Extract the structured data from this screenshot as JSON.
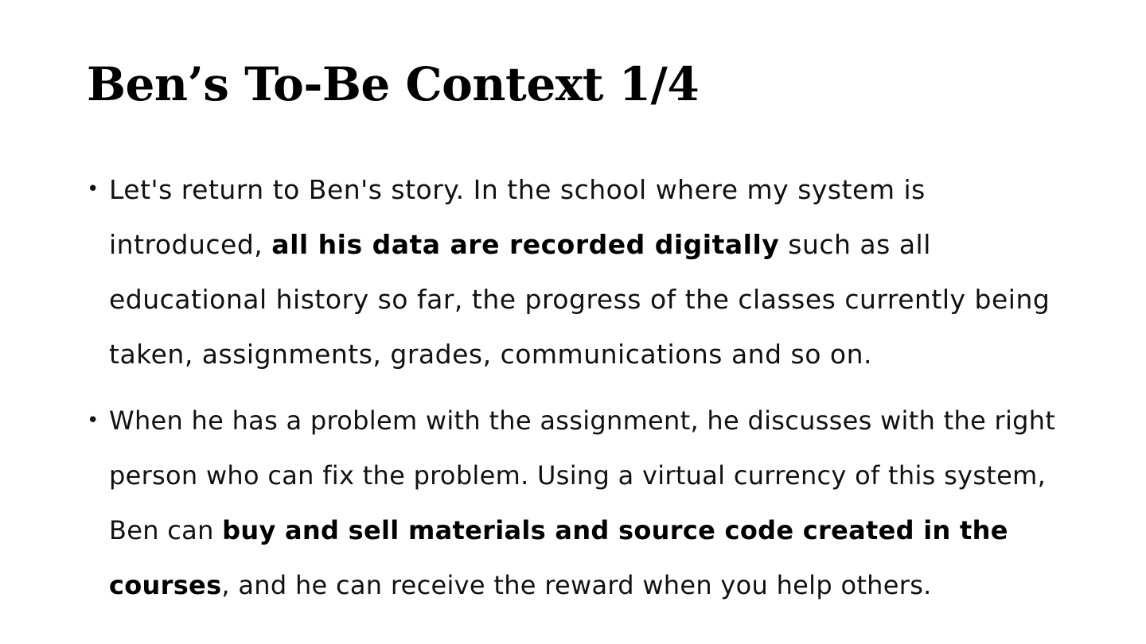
{
  "slide": {
    "title": "Ben’s To-Be Context 1/4",
    "bullet_marker": "•",
    "bullets": [
      {
        "segments": [
          {
            "text": "Let's return to Ben's story. In the school where my system is introduced, ",
            "bold": false
          },
          {
            "text": "all his data are recorded digitally",
            "bold": true
          },
          {
            "text": " such as all educational history so far, the progress of the classes currently being taken, assignments, grades, communications and so on.",
            "bold": false
          }
        ]
      },
      {
        "segments": [
          {
            "text": "When he has a problem with the assignment, he discusses with the right person who can fix the problem. Using a virtual currency of this system,  Ben can ",
            "bold": false
          },
          {
            "text": "buy and sell materials and source code created in the courses",
            "bold": true
          },
          {
            "text": ", and he can receive the reward when you help others.",
            "bold": false
          }
        ]
      }
    ]
  }
}
